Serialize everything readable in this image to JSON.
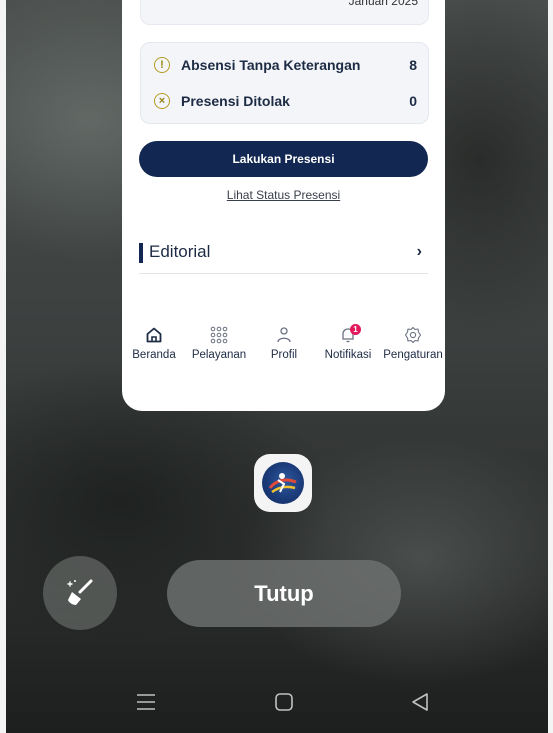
{
  "card": {
    "top_cut_text": "Januari 2025",
    "stats": [
      {
        "icon": "exclamation-icon",
        "label": "Absensi Tanpa Keterangan",
        "value": "8"
      },
      {
        "icon": "x-circle-icon",
        "label": "Presensi Ditolak",
        "value": "0"
      }
    ],
    "primary_button": "Lakukan Presensi",
    "status_link": "Lihat Status Presensi",
    "section_title": "Editorial",
    "bottom_nav": [
      {
        "icon": "home-icon",
        "label": "Beranda"
      },
      {
        "icon": "grid-icon",
        "label": "Pelayanan"
      },
      {
        "icon": "person-icon",
        "label": "Profil"
      },
      {
        "icon": "bell-icon",
        "label": "Notifikasi",
        "badge": "1"
      },
      {
        "icon": "gear-icon",
        "label": "Pengaturan"
      }
    ]
  },
  "close_button": "Tutup",
  "colors": {
    "primary": "#122751",
    "accent_badge": "#e2185b",
    "warning_icon": "#b59b22"
  }
}
